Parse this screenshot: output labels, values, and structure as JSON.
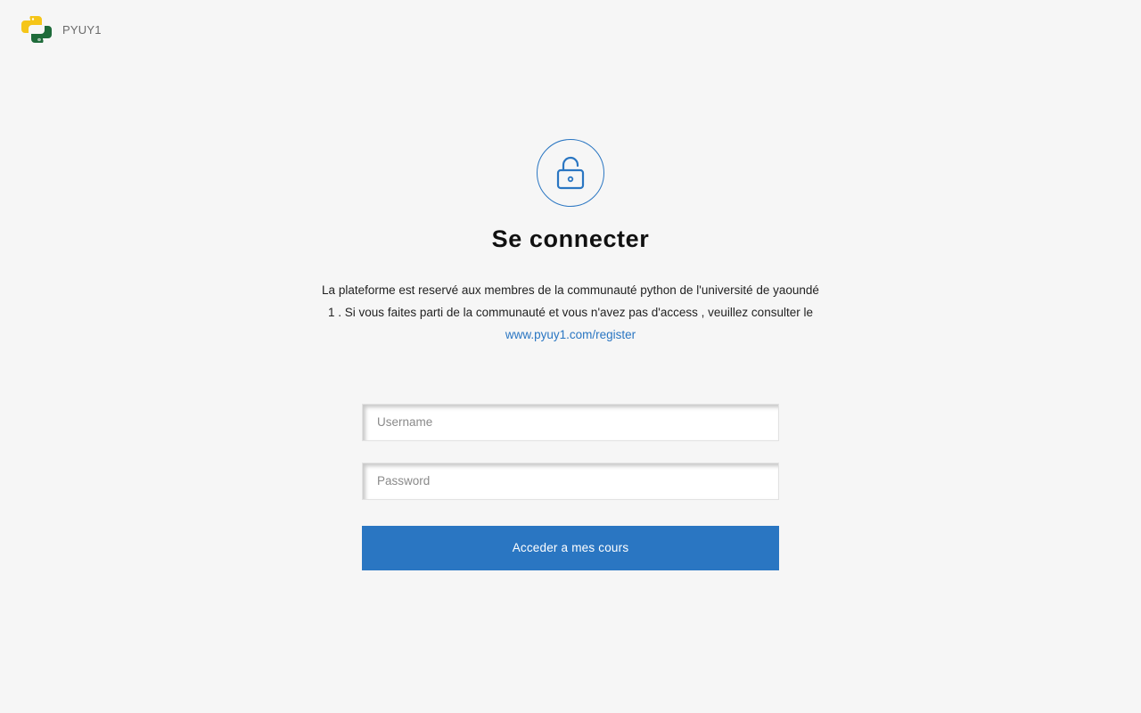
{
  "header": {
    "logo_icon": "python-logo-icon",
    "brand": "PYUY1"
  },
  "login": {
    "lock_icon": "unlocked-padlock-icon",
    "title": "Se connecter",
    "description": "La plateforme est reservé aux membres de la communauté python de l'université de yaoundé 1 . Si vous faites parti de la communauté et vous n'avez pas d'access , veuillez consulter le",
    "register_link": "www.pyuy1.com/register",
    "username_placeholder": "Username",
    "password_placeholder": "Password",
    "submit_label": "Acceder a mes cours"
  },
  "colors": {
    "accent": "#2a76c2",
    "background": "#f6f6f6",
    "logo_yellow": "#f5c518",
    "logo_green": "#1e6b3a"
  }
}
